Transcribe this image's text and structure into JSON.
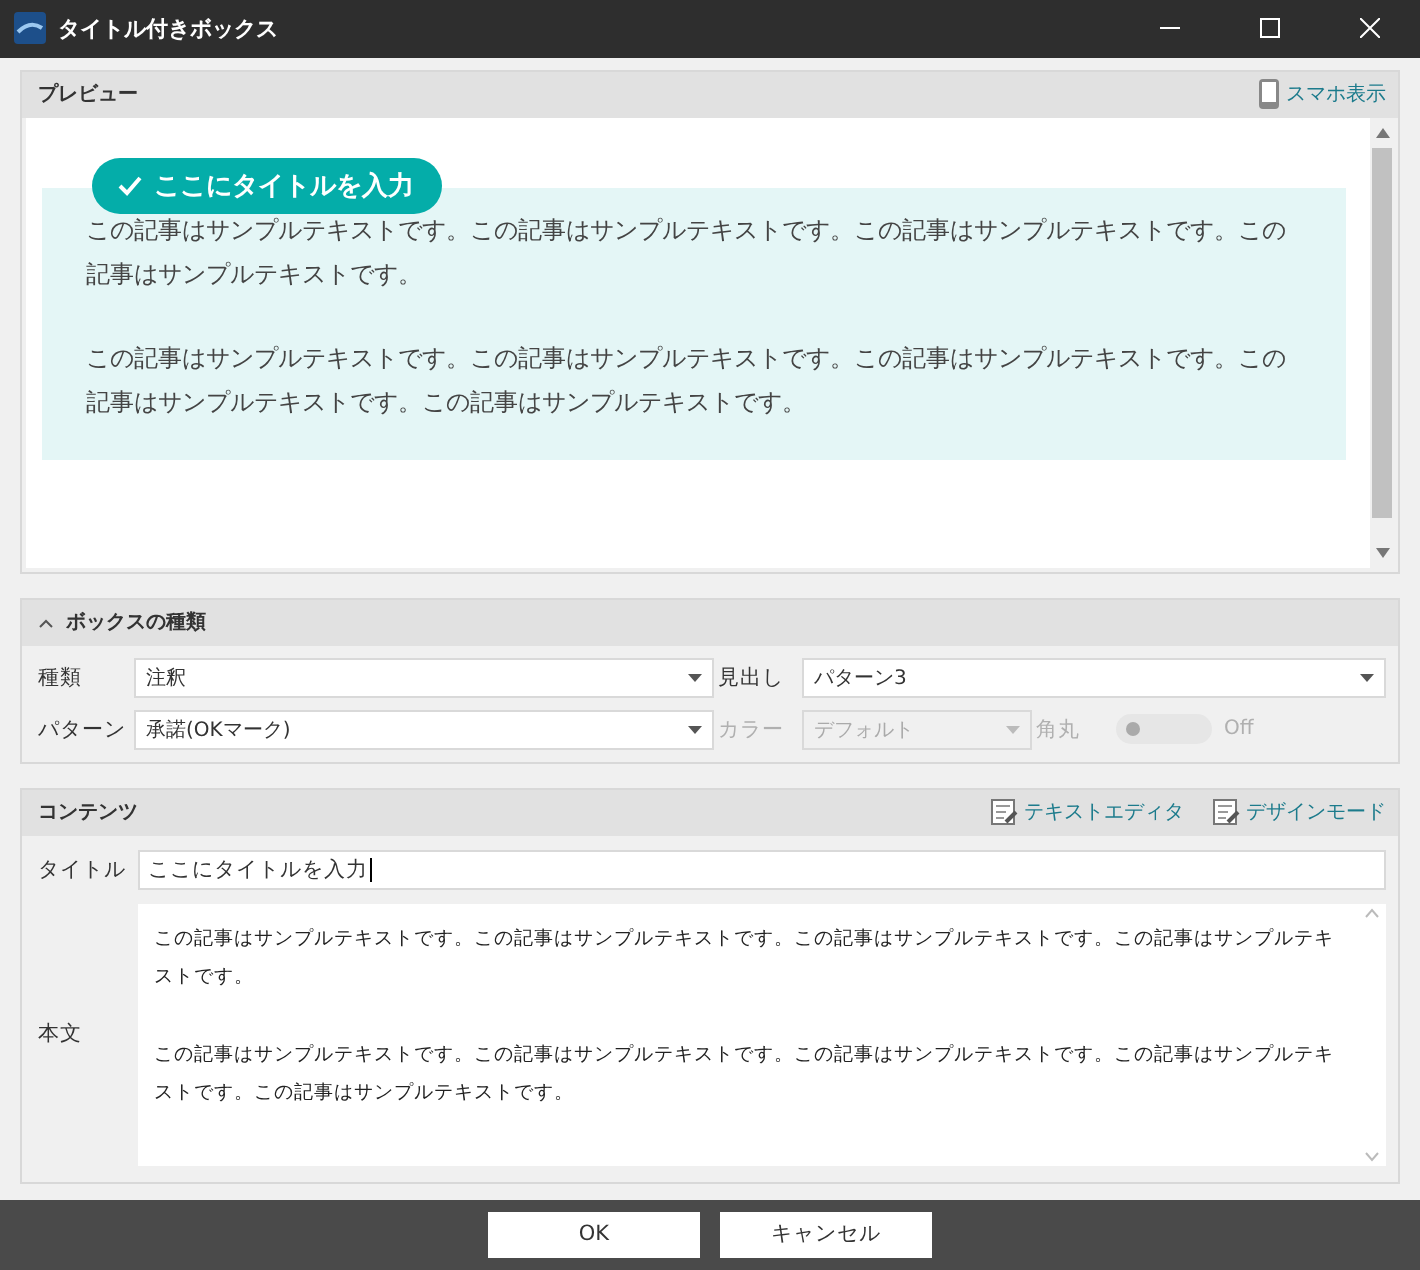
{
  "window": {
    "title": "タイトル付きボックス"
  },
  "preview": {
    "title": "プレビュー",
    "mobile_link": "スマホ表示",
    "box_title": "ここにタイトルを入力",
    "paragraphs": [
      "この記事はサンプルテキストです。この記事はサンプルテキストです。この記事はサンプルテキストです。この記事はサンプルテキストです。",
      "この記事はサンプルテキストです。この記事はサンプルテキストです。この記事はサンプルテキストです。この記事はサンプルテキストです。この記事はサンプルテキストです。"
    ]
  },
  "box_type": {
    "title": "ボックスの種類",
    "expanded": true,
    "fields": [
      {
        "kind": "select",
        "label": "種類",
        "value": "注釈",
        "disabled": false
      },
      {
        "kind": "select",
        "label": "見出し",
        "value": "パターン3",
        "disabled": false
      },
      {
        "kind": "select",
        "label": "パターン",
        "value": "承諾(OKマーク)",
        "disabled": false
      },
      {
        "kind": "select",
        "label": "カラー",
        "value": "デフォルト",
        "disabled": true
      },
      {
        "kind": "toggle",
        "label": "角丸",
        "value": "Off",
        "on": false,
        "disabled": true
      }
    ]
  },
  "contents": {
    "title": "コンテンツ",
    "actions": [
      "テキストエディタ",
      "デザインモード"
    ],
    "title_label": "タイトル",
    "title_value": "ここにタイトルを入力",
    "body_label": "本文",
    "body_paragraphs": [
      "この記事はサンプルテキストです。この記事はサンプルテキストです。この記事はサンプルテキストです。この記事はサンプルテキストです。",
      "この記事はサンプルテキストです。この記事はサンプルテキストです。この記事はサンプルテキストです。この記事はサンプルテキストです。この記事はサンプルテキストです。"
    ]
  },
  "buttons": [
    "OK",
    "キャンセル"
  ]
}
